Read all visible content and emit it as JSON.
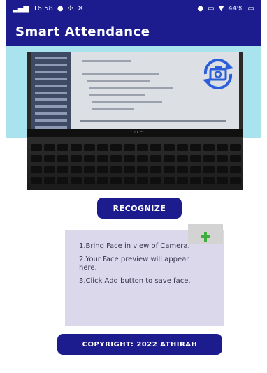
{
  "status_bar": {
    "time": "16:58",
    "left_icons": [
      "signal-icon",
      "signal-icon",
      "notification-dot-icon",
      "fan-icon",
      "tool-icon"
    ],
    "right_icons": [
      "record-icon",
      "cast-icon",
      "nfc-icon",
      "wifi-icon"
    ],
    "battery": "44%"
  },
  "app_bar": {
    "title": "Smart Attendance"
  },
  "camera": {
    "switch_icon": "switch-camera-icon",
    "brand": "acer"
  },
  "recognize_button": {
    "label": "RECOGNIZE"
  },
  "face_card": {
    "add_icon": "plus-icon",
    "instructions": [
      "1.Bring Face in view of Camera.",
      "2.Your Face preview will appear here.",
      "3.Click Add button to save face."
    ]
  },
  "copyright_button": {
    "label": "COPYRIGHT: 2022 ATHIRAH"
  },
  "colors": {
    "primary": "#1c1c8f",
    "teal_band": "#a9e3ee",
    "card_bg": "#dcd8ec",
    "add_icon": "#3fae3f"
  }
}
